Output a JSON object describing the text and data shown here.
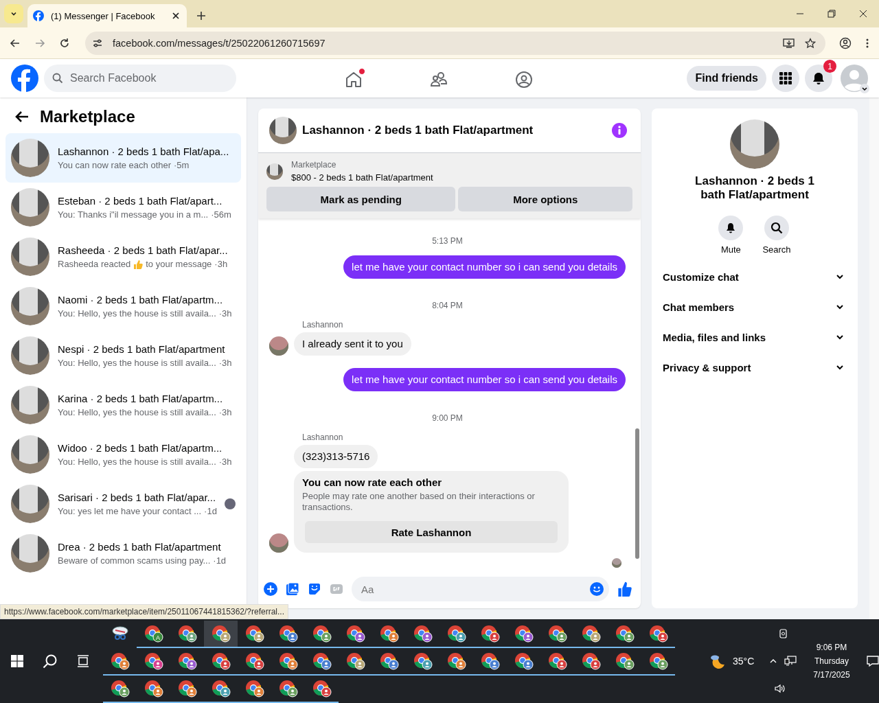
{
  "browser": {
    "tab_title": "(1) Messenger | Facebook",
    "url": "facebook.com/messages/t/25022061260715697"
  },
  "header": {
    "search_placeholder": "Search Facebook",
    "nav": [
      {
        "kind": "home",
        "badge": true
      },
      {
        "kind": "friends",
        "badge": false
      },
      {
        "kind": "groups",
        "badge": false
      }
    ],
    "find_friends": "Find friends",
    "notification_count": "1"
  },
  "sidebar": {
    "title": "Marketplace",
    "conversations": [
      {
        "name": "Lashannon · 2 beds 1 bath Flat/apa...",
        "preview": "You can now rate each other",
        "time": "·5m",
        "selected": true,
        "seen_avatar": false
      },
      {
        "name": "Esteban · 2 beds 1 bath Flat/apart...",
        "preview": "You: Thanks i\"il message you in a m...",
        "time": "·56m",
        "selected": false,
        "seen_avatar": false
      },
      {
        "name": "Rasheeda · 2 beds 1 bath Flat/apar...",
        "preview": "Rasheeda reacted",
        "reaction": true,
        "preview_end": "to your message",
        "time": "·3h",
        "selected": false,
        "seen_avatar": false
      },
      {
        "name": "Naomi · 2 beds 1 bath Flat/apartm...",
        "preview": "You: Hello, yes the house is still availa...",
        "time": "·3h",
        "selected": false,
        "seen_avatar": false
      },
      {
        "name": "Nespi · 2 beds 1 bath Flat/apartment",
        "preview": "You: Hello, yes the house is still availa...",
        "time": "·3h",
        "selected": false,
        "seen_avatar": false
      },
      {
        "name": "Karina · 2 beds 1 bath Flat/apartm...",
        "preview": "You: Hello, yes the house is still availa...",
        "time": "·3h",
        "selected": false,
        "seen_avatar": false
      },
      {
        "name": "Widoo · 2 beds 1 bath Flat/apartm...",
        "preview": "You: Hello, yes the house is still availa...",
        "time": "·3h",
        "selected": false,
        "seen_avatar": false
      },
      {
        "name": "Sarisari · 2 beds 1 bath Flat/apar...",
        "preview": "You: yes let me have your contact ...",
        "time": "·1d",
        "selected": false,
        "seen_avatar": true
      },
      {
        "name": "Drea · 2 beds 1 bath Flat/apartment",
        "preview": "Beware of common scams using pay...",
        "time": "·1d",
        "selected": false,
        "seen_avatar": false
      }
    ]
  },
  "chat": {
    "title": "Lashannon · 2 beds 1 bath Flat/apartment",
    "listing": {
      "label": "Marketplace",
      "title": "$800 - 2 beds 1 bath Flat/apartment",
      "buttons": [
        "Mark as pending",
        "More options"
      ]
    },
    "messages": [
      {
        "kind": "time",
        "text": "5:13 PM"
      },
      {
        "kind": "out",
        "text": "let me have your contact number so i can send you details"
      },
      {
        "kind": "time",
        "text": "8:04 PM"
      },
      {
        "kind": "in",
        "sender": "Lashannon",
        "text": "I already sent it to you",
        "avatar": true
      },
      {
        "kind": "out",
        "text": "let me have your contact number so i can send you details"
      },
      {
        "kind": "time",
        "text": "9:00 PM"
      },
      {
        "kind": "in",
        "sender": "Lashannon",
        "text": "(323)313-5716",
        "avatar": false
      },
      {
        "kind": "rating",
        "title": "You can now rate each other",
        "body": "People may rate one another based on their interactions or transactions.",
        "button": "Rate Lashannon",
        "avatar": true
      }
    ],
    "composer_placeholder": "Aa"
  },
  "details": {
    "name": "Lashannon · 2 beds 1 bath Flat/apartment",
    "actions": [
      {
        "kind": "mute",
        "label": "Mute"
      },
      {
        "kind": "search",
        "label": "Search"
      }
    ],
    "sections": [
      {
        "label": "Customize chat",
        "expanded": false
      },
      {
        "label": "Chat members",
        "expanded": false
      },
      {
        "label": "Media, files and links",
        "expanded": false
      },
      {
        "label": "Privacy & support",
        "expanded": false
      }
    ]
  },
  "status_url": "https://www.facebook.com/marketplace/item/25011067441815362/?referral...",
  "taskbar": {
    "apps": [
      {
        "kind": "snip",
        "selected": false
      },
      {
        "kind": "chrome",
        "color": "#3b8a3e",
        "letter": "A",
        "selected": false
      },
      {
        "kind": "chrome",
        "color": "#6fa882",
        "selected": false
      },
      {
        "kind": "chrome",
        "color": "#b8a878",
        "selected": true
      },
      {
        "kind": "chrome",
        "color": "#b8a878",
        "selected": false
      },
      {
        "kind": "chrome",
        "color": "#4a7fd0",
        "selected": false
      },
      {
        "kind": "chrome",
        "color": "#6aa060",
        "selected": false
      },
      {
        "kind": "chrome",
        "color": "#9a5cd0",
        "selected": false
      },
      {
        "kind": "chrome",
        "color": "#e0803a",
        "selected": false
      },
      {
        "kind": "chrome",
        "color": "#9a5cd0",
        "selected": false
      },
      {
        "kind": "chrome",
        "color": "#4aa0b0",
        "selected": false
      },
      {
        "kind": "chrome",
        "color": "#d84040",
        "selected": false
      },
      {
        "kind": "chrome",
        "color": "#9a5cd0",
        "selected": false
      },
      {
        "kind": "chrome",
        "color": "#6aa060",
        "selected": false
      },
      {
        "kind": "chrome",
        "color": "#b8a878",
        "selected": false
      },
      {
        "kind": "chrome",
        "color": "#6aa060",
        "selected": false
      },
      {
        "kind": "chrome",
        "color": "#d84040",
        "selected": false
      },
      {
        "kind": "chrome",
        "color": "#e0803a",
        "selected": false
      },
      {
        "kind": "chrome",
        "color": "#d84090",
        "selected": false
      },
      {
        "kind": "chrome",
        "color": "#9a5cd0",
        "selected": false
      },
      {
        "kind": "chrome",
        "color": "#d84040",
        "selected": false
      },
      {
        "kind": "chrome",
        "color": "#d84040",
        "selected": false
      },
      {
        "kind": "chrome",
        "color": "#e0803a",
        "selected": false
      },
      {
        "kind": "chrome",
        "color": "#4a7fd0",
        "selected": false
      },
      {
        "kind": "chrome",
        "color": "#b8a878",
        "selected": false
      },
      {
        "kind": "chrome",
        "color": "#4a7fd0",
        "selected": false
      },
      {
        "kind": "chrome",
        "color": "#4aa0b0",
        "selected": false
      },
      {
        "kind": "chrome",
        "color": "#e0803a",
        "selected": false
      },
      {
        "kind": "chrome",
        "color": "#4a7fd0",
        "selected": false
      },
      {
        "kind": "chrome",
        "color": "#4a7fd0",
        "selected": false
      },
      {
        "kind": "chrome",
        "color": "#d84040",
        "selected": false
      },
      {
        "kind": "chrome",
        "color": "#d84040",
        "selected": false
      },
      {
        "kind": "chrome",
        "color": "#6aa060",
        "selected": false
      },
      {
        "kind": "chrome",
        "color": "#6aa060",
        "selected": false
      },
      {
        "kind": "chrome",
        "color": "#6aa060",
        "selected": false
      },
      {
        "kind": "chrome",
        "color": "#e0803a",
        "selected": false
      },
      {
        "kind": "chrome",
        "color": "#e0803a",
        "selected": false
      },
      {
        "kind": "chrome",
        "color": "#4aa0b0",
        "selected": false
      },
      {
        "kind": "chrome",
        "color": "#e0803a",
        "selected": false
      },
      {
        "kind": "chrome",
        "color": "#6aa060",
        "selected": false
      },
      {
        "kind": "chrome",
        "color": "#d84040",
        "selected": false
      }
    ],
    "temperature": "35°C",
    "time": "9:06 PM",
    "day": "Thursday",
    "date": "7/17/2025"
  }
}
